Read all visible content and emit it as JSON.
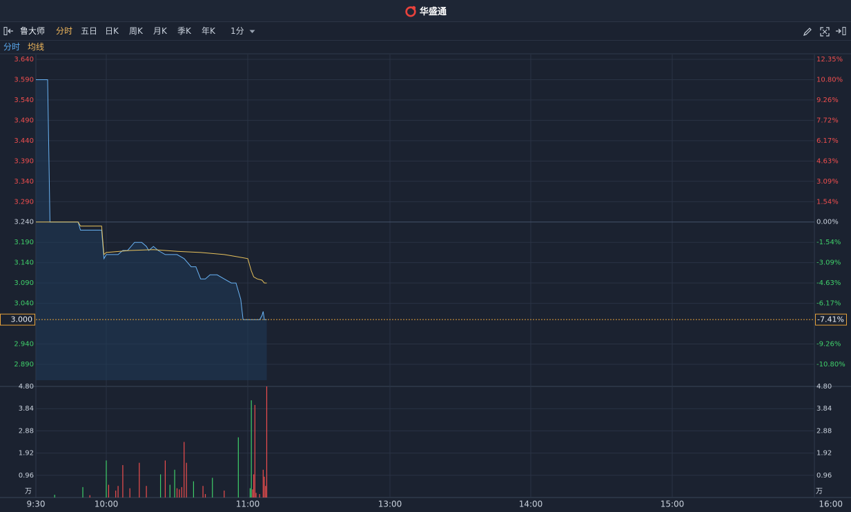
{
  "brand": {
    "name": "华盛通"
  },
  "toolbar": {
    "stock_name": "鲁大师",
    "periods": [
      "分时",
      "五日",
      "日K",
      "周K",
      "月K",
      "季K",
      "年K"
    ],
    "active_period": "分时",
    "interval": "1分"
  },
  "indicator_tabs": [
    {
      "label": "分时",
      "color": "#5aa9f0"
    },
    {
      "label": "均线",
      "color": "#f0b75b"
    }
  ],
  "colors": {
    "background": "#1b2230",
    "grid": "#2a3344",
    "price_line": "#6ab4f5",
    "avg_line": "#e8c25c",
    "up": "#ef4e4e",
    "down": "#3fcf6a",
    "current_price": "#e8a33a"
  },
  "chart_data": [
    {
      "type": "line",
      "name_cn": "分时",
      "x_ticks": [
        "9:30",
        "10:00",
        "11:00",
        "13:00",
        "14:00",
        "15:00",
        "16:00"
      ],
      "y_left_ticks": [
        "3.640",
        "3.590",
        "3.540",
        "3.490",
        "3.440",
        "3.390",
        "3.340",
        "3.290",
        "3.240",
        "3.190",
        "3.140",
        "3.090",
        "3.040",
        "2.940",
        "2.890"
      ],
      "y_right_ticks": [
        "12.35%",
        "10.80%",
        "9.26%",
        "7.72%",
        "6.17%",
        "4.63%",
        "3.09%",
        "1.54%",
        "0.00%",
        "-1.54%",
        "-3.09%",
        "-4.63%",
        "-6.17%",
        "-9.26%",
        "-10.80%"
      ],
      "ylim": [
        2.865,
        3.64
      ],
      "prev_close": 3.24,
      "current_price_label": "3.000",
      "current_change_label": "-7.41%",
      "current_price": 3.0,
      "series": [
        {
          "name": "分时",
          "points": [
            [
              "9:30",
              3.59
            ],
            [
              "9:35",
              3.59
            ],
            [
              "9:36",
              3.24
            ],
            [
              "9:40",
              3.24
            ],
            [
              "9:45",
              3.24
            ],
            [
              "9:48",
              3.24
            ],
            [
              "9:49",
              3.22
            ],
            [
              "9:55",
              3.22
            ],
            [
              "9:58",
              3.22
            ],
            [
              "9:59",
              3.15
            ],
            [
              "10:00",
              3.16
            ],
            [
              "10:02",
              3.16
            ],
            [
              "10:05",
              3.16
            ],
            [
              "10:07",
              3.17
            ],
            [
              "10:09",
              3.17
            ],
            [
              "10:12",
              3.19
            ],
            [
              "10:15",
              3.19
            ],
            [
              "10:17",
              3.18
            ],
            [
              "10:18",
              3.17
            ],
            [
              "10:20",
              3.18
            ],
            [
              "10:22",
              3.17
            ],
            [
              "10:25",
              3.16
            ],
            [
              "10:30",
              3.16
            ],
            [
              "10:33",
              3.15
            ],
            [
              "10:36",
              3.13
            ],
            [
              "10:38",
              3.13
            ],
            [
              "10:40",
              3.1
            ],
            [
              "10:42",
              3.1
            ],
            [
              "10:44",
              3.11
            ],
            [
              "10:47",
              3.11
            ],
            [
              "10:50",
              3.1
            ],
            [
              "10:53",
              3.09
            ],
            [
              "10:55",
              3.09
            ],
            [
              "10:57",
              3.05
            ],
            [
              "10:58",
              3.0
            ],
            [
              "11:00",
              3.0
            ],
            [
              "11:05",
              3.0
            ],
            [
              "11:08",
              3.0
            ],
            [
              "11:10",
              3.0
            ],
            [
              "11:12",
              3.01
            ],
            [
              "11:13",
              3.02
            ],
            [
              "11:14",
              3.0
            ],
            [
              "11:16",
              3.0
            ]
          ]
        },
        {
          "name": "均线",
          "points": [
            [
              "9:30",
              3.24
            ],
            [
              "9:48",
              3.24
            ],
            [
              "9:49",
              3.23
            ],
            [
              "9:58",
              3.23
            ],
            [
              "9:59",
              3.16
            ],
            [
              "10:00",
              3.165
            ],
            [
              "10:10",
              3.17
            ],
            [
              "10:20",
              3.172
            ],
            [
              "10:30",
              3.168
            ],
            [
              "10:40",
              3.165
            ],
            [
              "10:50",
              3.16
            ],
            [
              "10:55",
              3.155
            ],
            [
              "11:00",
              3.15
            ],
            [
              "11:01",
              3.14
            ],
            [
              "11:03",
              3.12
            ],
            [
              "11:05",
              3.105
            ],
            [
              "11:08",
              3.1
            ],
            [
              "11:12",
              3.097
            ],
            [
              "11:14",
              3.09
            ],
            [
              "11:16",
              3.09
            ]
          ]
        }
      ]
    },
    {
      "type": "bar",
      "name_cn": "成交量",
      "unit": "万",
      "y_ticks": [
        "4.80",
        "3.84",
        "2.88",
        "1.92",
        "0.96"
      ],
      "ylim": [
        0,
        4.8
      ],
      "bars": [
        {
          "x": "9:38",
          "value": 0.12,
          "dir": "down"
        },
        {
          "x": "9:50",
          "value": 0.45,
          "dir": "down"
        },
        {
          "x": "9:53",
          "value": 0.1,
          "dir": "up"
        },
        {
          "x": "10:00",
          "value": 1.6,
          "dir": "down"
        },
        {
          "x": "10:01",
          "value": 0.55,
          "dir": "up"
        },
        {
          "x": "10:04",
          "value": 0.3,
          "dir": "up"
        },
        {
          "x": "10:05",
          "value": 0.5,
          "dir": "up"
        },
        {
          "x": "10:07",
          "value": 1.4,
          "dir": "up"
        },
        {
          "x": "10:10",
          "value": 0.4,
          "dir": "up"
        },
        {
          "x": "10:14",
          "value": 1.5,
          "dir": "up"
        },
        {
          "x": "10:17",
          "value": 0.5,
          "dir": "up"
        },
        {
          "x": "10:23",
          "value": 1.0,
          "dir": "down"
        },
        {
          "x": "10:25",
          "value": 1.6,
          "dir": "up"
        },
        {
          "x": "10:27",
          "value": 0.55,
          "dir": "down"
        },
        {
          "x": "10:29",
          "value": 1.2,
          "dir": "down"
        },
        {
          "x": "10:30",
          "value": 0.4,
          "dir": "up"
        },
        {
          "x": "10:31",
          "value": 0.35,
          "dir": "up"
        },
        {
          "x": "10:32",
          "value": 0.45,
          "dir": "up"
        },
        {
          "x": "10:33",
          "value": 2.4,
          "dir": "up"
        },
        {
          "x": "10:34",
          "value": 1.5,
          "dir": "up"
        },
        {
          "x": "10:37",
          "value": 0.7,
          "dir": "down"
        },
        {
          "x": "10:41",
          "value": 0.5,
          "dir": "up"
        },
        {
          "x": "10:42",
          "value": 0.15,
          "dir": "up"
        },
        {
          "x": "10:45",
          "value": 0.85,
          "dir": "down"
        },
        {
          "x": "10:50",
          "value": 0.3,
          "dir": "up"
        },
        {
          "x": "10:56",
          "value": 2.6,
          "dir": "down"
        },
        {
          "x": "11:02",
          "value": 0.4,
          "dir": "down"
        },
        {
          "x": "11:03",
          "value": 4.2,
          "dir": "down"
        },
        {
          "x": "11:04",
          "value": 0.35,
          "dir": "up"
        },
        {
          "x": "11:05",
          "value": 1.0,
          "dir": "up"
        },
        {
          "x": "11:06",
          "value": 4.0,
          "dir": "up"
        },
        {
          "x": "11:07",
          "value": 0.2,
          "dir": "up"
        },
        {
          "x": "11:10",
          "value": 0.15,
          "dir": "up"
        },
        {
          "x": "11:13",
          "value": 1.2,
          "dir": "up"
        },
        {
          "x": "11:14",
          "value": 0.9,
          "dir": "up"
        },
        {
          "x": "11:15",
          "value": 0.5,
          "dir": "up"
        },
        {
          "x": "11:16",
          "value": 4.8,
          "dir": "up"
        }
      ]
    }
  ]
}
